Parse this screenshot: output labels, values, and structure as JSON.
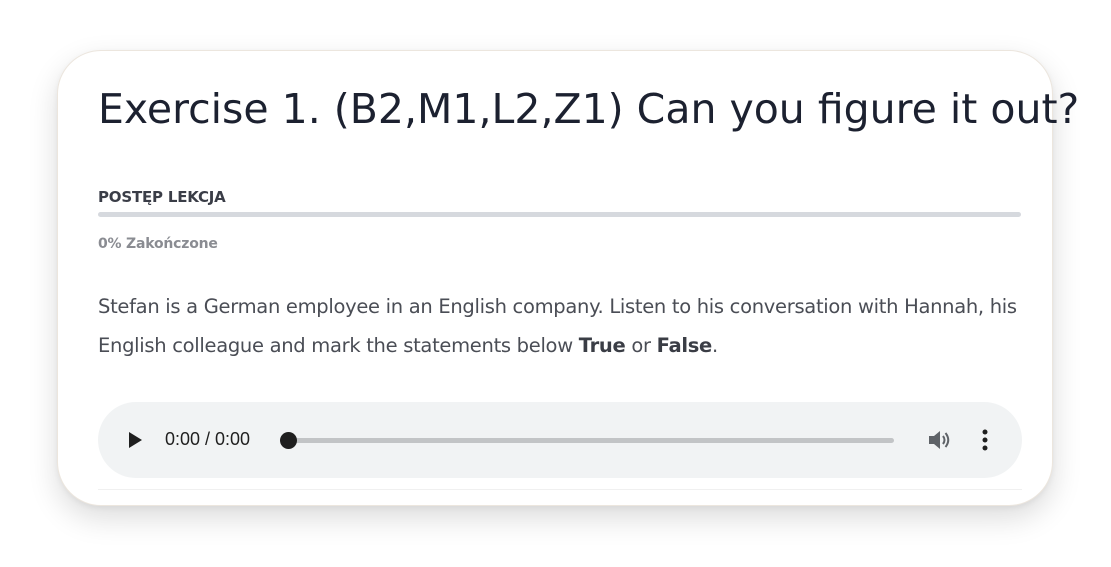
{
  "exercise": {
    "title": "Exercise 1. (B2,M1,L2,Z1) Can you figure it out?",
    "progress_label": "POSTĘP LEKCJA",
    "progress_percent": 0,
    "progress_text": "0% Zakończone"
  },
  "description": {
    "text_before": "Stefan is a German employee in an English company. Listen to his conversation with Hannah, his English colleague and mark the statements below ",
    "true_word": "True",
    "or_word": " or ",
    "false_word": "False",
    "end": "."
  },
  "audio_player": {
    "time_display": "0:00 / 0:00",
    "play_icon": "play-icon",
    "volume_icon": "volume-icon",
    "menu_icon": "more-vert-icon",
    "seek_position": 0
  }
}
